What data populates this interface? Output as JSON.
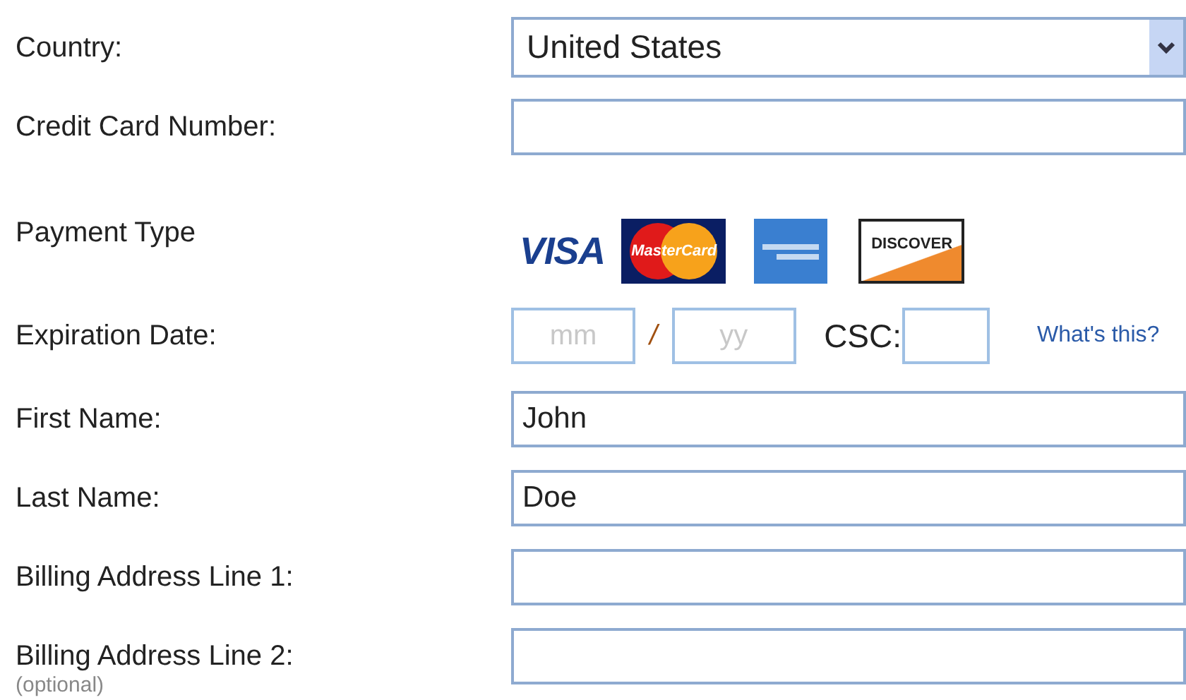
{
  "fields": [
    {
      "kind": "select",
      "label": "Country:",
      "value": "United States"
    },
    {
      "kind": "text",
      "label": "Credit Card Number:"
    },
    {
      "kind": "cards",
      "label": "Payment Type",
      "cards": [
        {
          "kind": "visa",
          "label": "VISA"
        },
        {
          "kind": "mastercard",
          "label": "MasterCard"
        },
        {
          "kind": "amex"
        },
        {
          "kind": "discover",
          "label": "DISCOVER"
        }
      ]
    },
    {
      "kind": "expiry",
      "label": "Expiration Date:",
      "month_placeholder": "mm",
      "separator": "/",
      "year_placeholder": "yy",
      "csc_label": "CSC:",
      "help_link": "What's this?"
    },
    {
      "kind": "text",
      "label": "First Name:",
      "value": "John"
    },
    {
      "kind": "text",
      "label": "Last Name:",
      "value": "Doe"
    },
    {
      "kind": "text",
      "label": "Billing Address Line 1:"
    },
    {
      "kind": "text",
      "label": "Billing Address Line 2:",
      "note": "(optional)"
    }
  ]
}
